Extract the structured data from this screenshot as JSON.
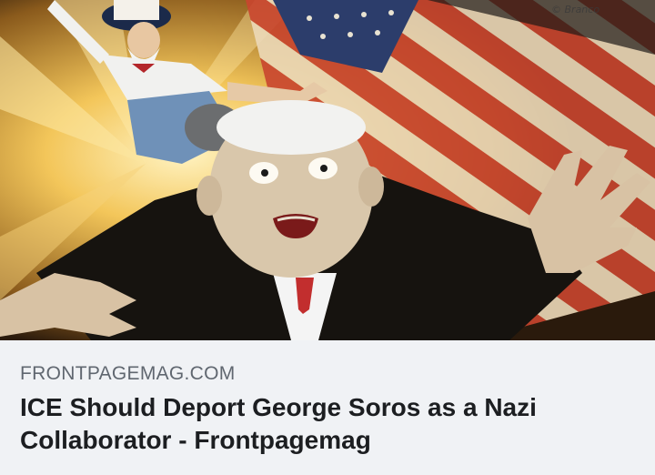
{
  "link_preview": {
    "image": {
      "description_icon": "cartoon-illustration-icon",
      "watermark": "© Branco"
    },
    "domain": "FRONTPAGEMAG.COM",
    "title": "ICE Should Deport George Soros as a Nazi Collaborator - Frontpagemag"
  },
  "colors": {
    "footer_bg": "#f0f2f5",
    "domain_text": "#606770",
    "title_text": "#1c1e21"
  }
}
